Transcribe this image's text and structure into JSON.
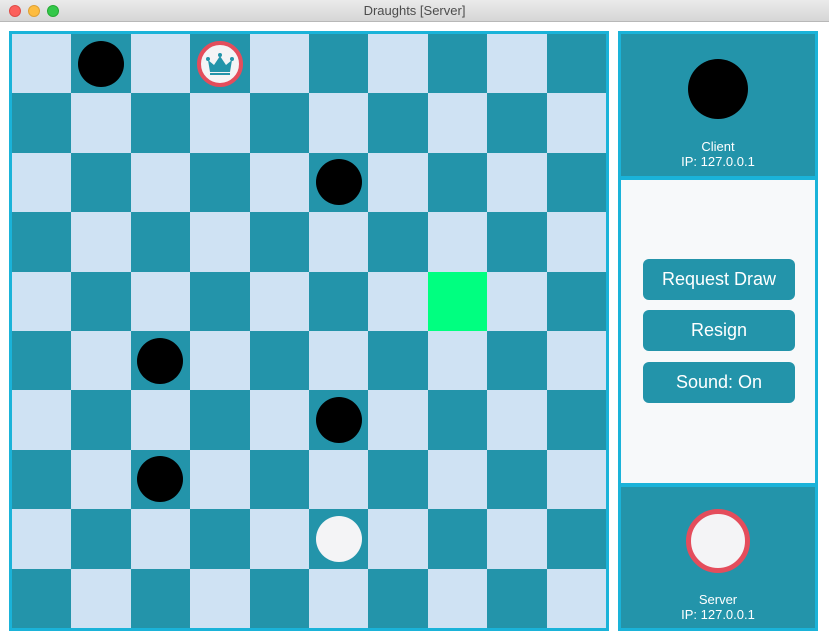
{
  "window": {
    "title": "Draughts [Server]"
  },
  "board": {
    "size": 10,
    "highlight": {
      "row": 4,
      "col": 7
    },
    "pieces": [
      {
        "row": 0,
        "col": 1,
        "color": "black",
        "king": false
      },
      {
        "row": 0,
        "col": 3,
        "color": "white",
        "king": true
      },
      {
        "row": 2,
        "col": 5,
        "color": "black",
        "king": false
      },
      {
        "row": 5,
        "col": 2,
        "color": "black",
        "king": false
      },
      {
        "row": 6,
        "col": 5,
        "color": "black",
        "king": false
      },
      {
        "row": 7,
        "col": 2,
        "color": "black",
        "king": false
      },
      {
        "row": 8,
        "col": 5,
        "color": "white",
        "king": false
      }
    ]
  },
  "client": {
    "name": "Client",
    "ip": "IP: 127.0.0.1"
  },
  "server": {
    "name": "Server",
    "ip": "IP: 127.0.0.1"
  },
  "controls": {
    "request_draw": "Request Draw",
    "resign": "Resign",
    "sound": "Sound: On"
  },
  "colors": {
    "light_square": "#cfe2f3",
    "dark_square": "#2394aa",
    "highlight": "#00ff80",
    "frame": "#1ab3d9",
    "king_ring": "#e44d5c"
  },
  "icons": {
    "king": "crown-icon"
  }
}
